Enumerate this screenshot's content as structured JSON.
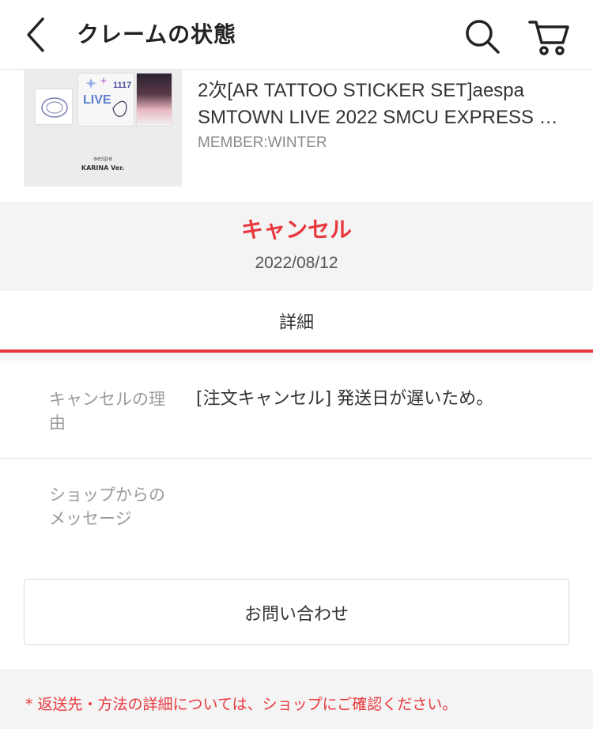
{
  "header": {
    "title": "クレームの状態",
    "icons": {
      "back": "chevron-left-icon",
      "search": "search-icon",
      "cart": "cart-icon"
    }
  },
  "product": {
    "name": "2次[AR TATTOO STICKER SET]aespa SMTOWN LIVE 2022 SMCU EXPRESS …",
    "option": "MEMBER:WINTER",
    "thumbnail": {
      "sticker_text": "1117",
      "live_text": "LIVE",
      "caption_group": "aespa",
      "caption_version": "KARINA Ver."
    }
  },
  "status": {
    "label": "キャンセル",
    "date": "2022/08/12"
  },
  "tab": {
    "label": "詳細"
  },
  "details": [
    {
      "label": "キャンセルの理由",
      "value": "[注文キャンセル] 発送日が遅いため。"
    },
    {
      "label": "ショップからのメッセージ",
      "value": ""
    }
  ],
  "contact_button": {
    "label": "お問い合わせ"
  },
  "note": {
    "text": "* 返送先・方法の詳細については、ショップにご確認ください。"
  },
  "colors": {
    "accent": "#e8383d",
    "band": "#f4f4f5",
    "muted": "#9a9a9a"
  }
}
